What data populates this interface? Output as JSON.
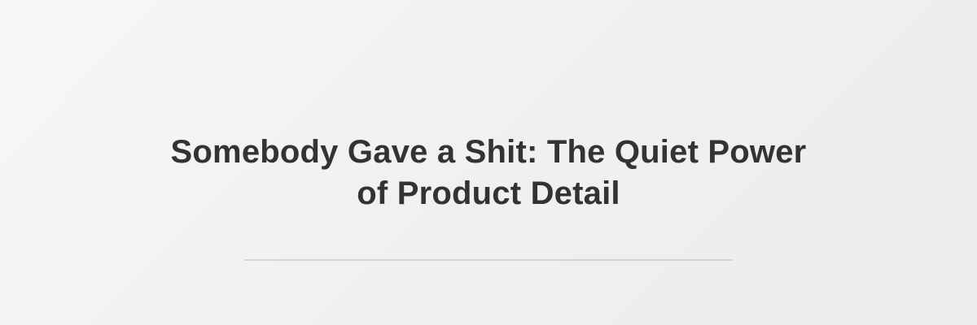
{
  "hero": {
    "title": "Somebody Gave a Shit: The Quiet Power of Product Detail"
  },
  "colors": {
    "background": "#f1f1f1",
    "title_text": "#333333",
    "divider": "#d4d4d4"
  }
}
